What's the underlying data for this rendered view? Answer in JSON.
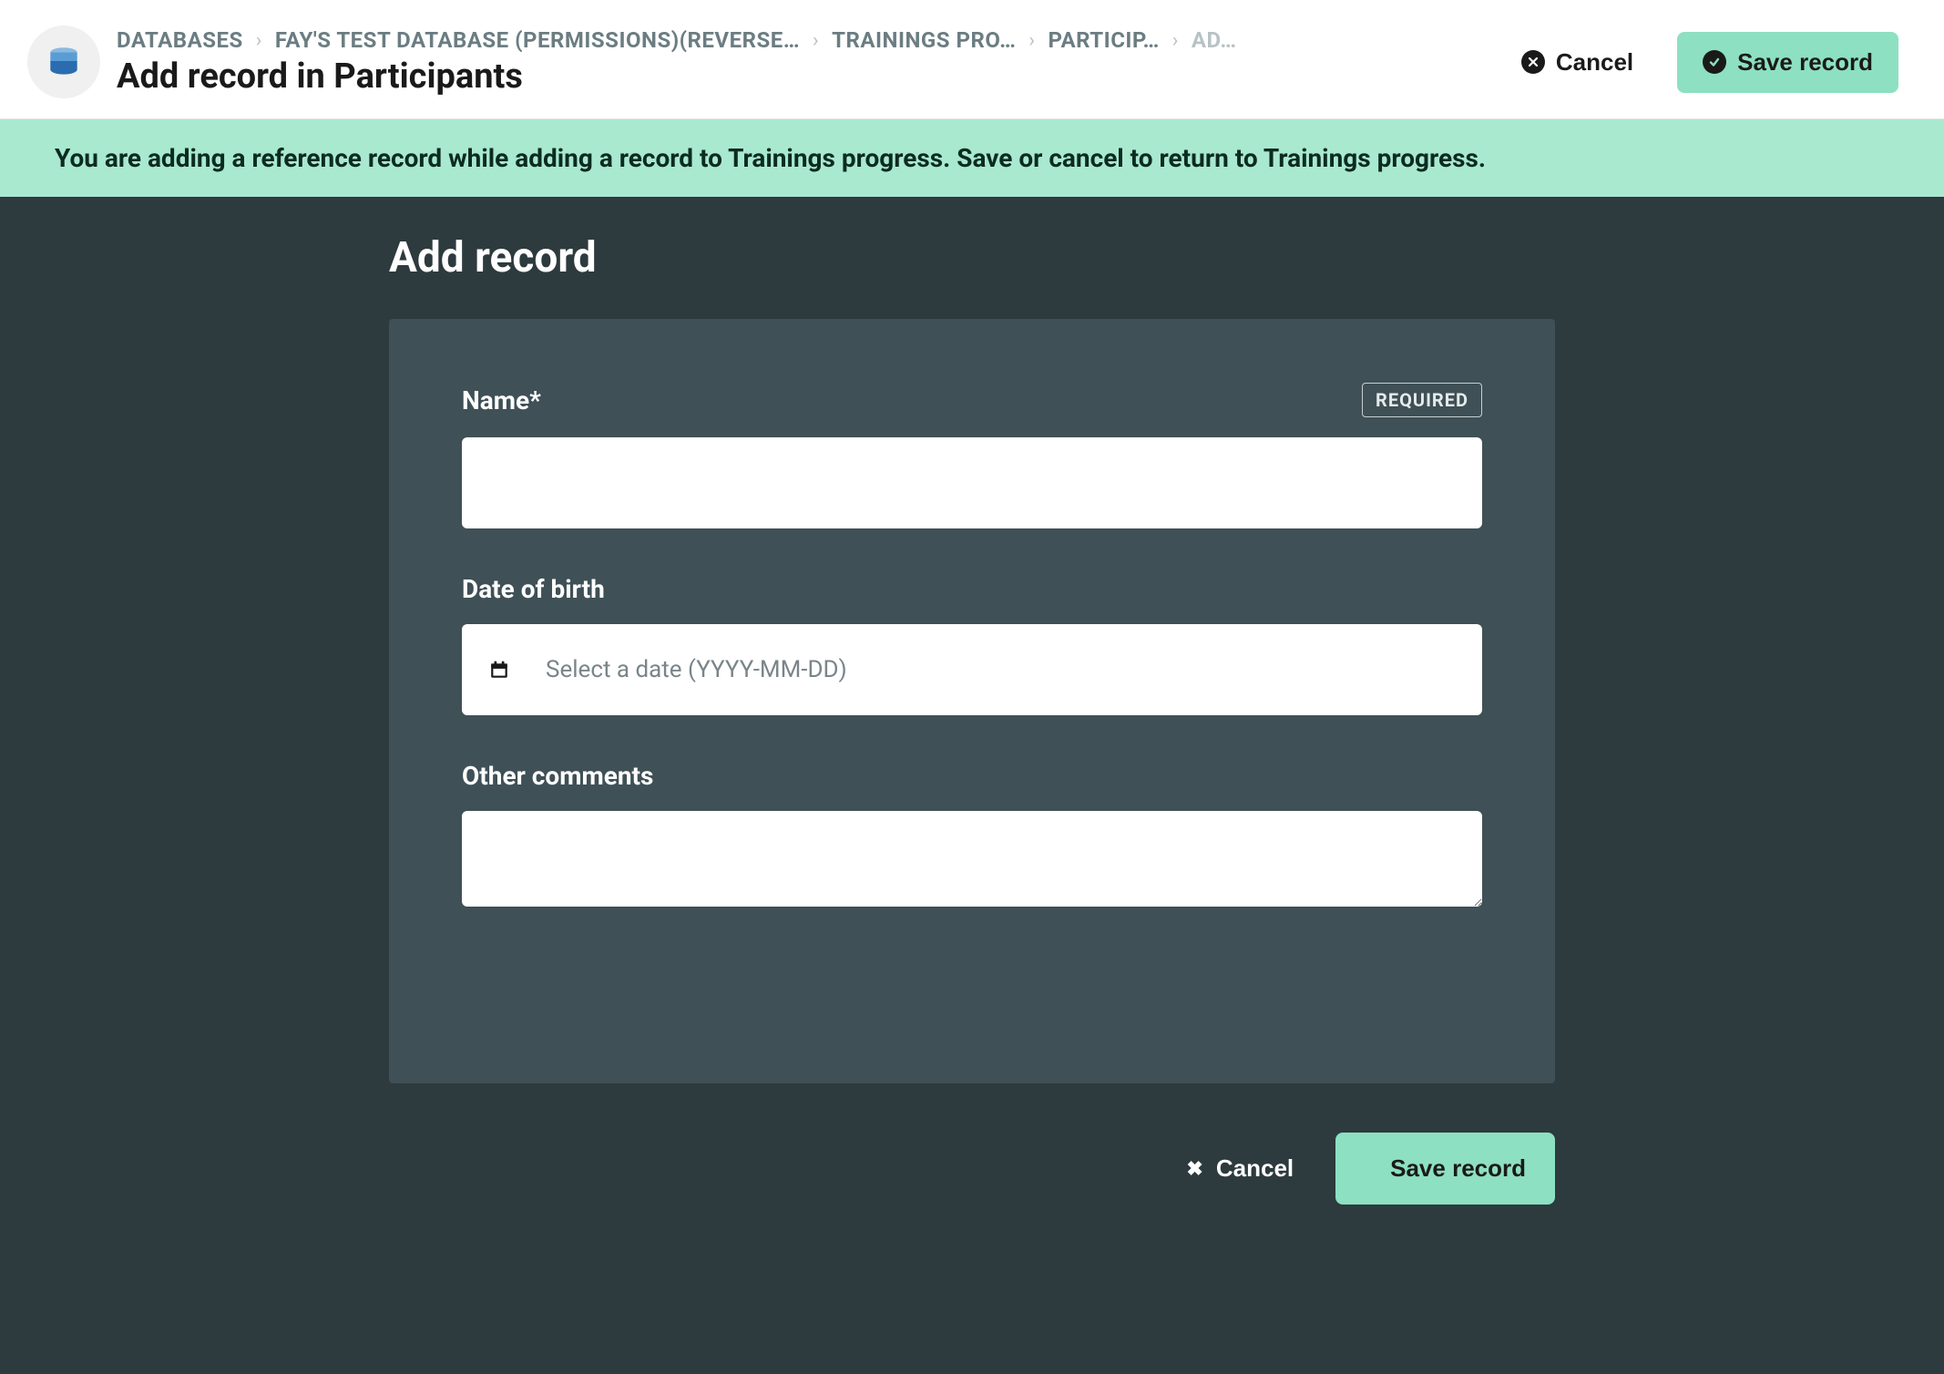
{
  "header": {
    "breadcrumbs": [
      {
        "label": "DATABASES"
      },
      {
        "label": "FAY'S TEST DATABASE (PERMISSIONS)(REVERSE…"
      },
      {
        "label": "TRAININGS PRO…"
      },
      {
        "label": "PARTICIP…"
      },
      {
        "label": "AD…",
        "muted": true
      }
    ],
    "title": "Add record in Participants",
    "cancel_label": "Cancel",
    "save_label": "Save record"
  },
  "banner": {
    "message": "You are adding a reference record while adding a record to Trainings progress. Save or cancel to return to Trainings progress."
  },
  "form": {
    "section_title": "Add record",
    "fields": {
      "name": {
        "label": "Name*",
        "required_badge": "REQUIRED",
        "value": ""
      },
      "dob": {
        "label": "Date of birth",
        "placeholder": "Select a date (YYYY-MM-DD)",
        "value": ""
      },
      "comments": {
        "label": "Other comments",
        "value": ""
      }
    }
  },
  "footer": {
    "cancel_label": "Cancel",
    "save_label": "Save record"
  }
}
